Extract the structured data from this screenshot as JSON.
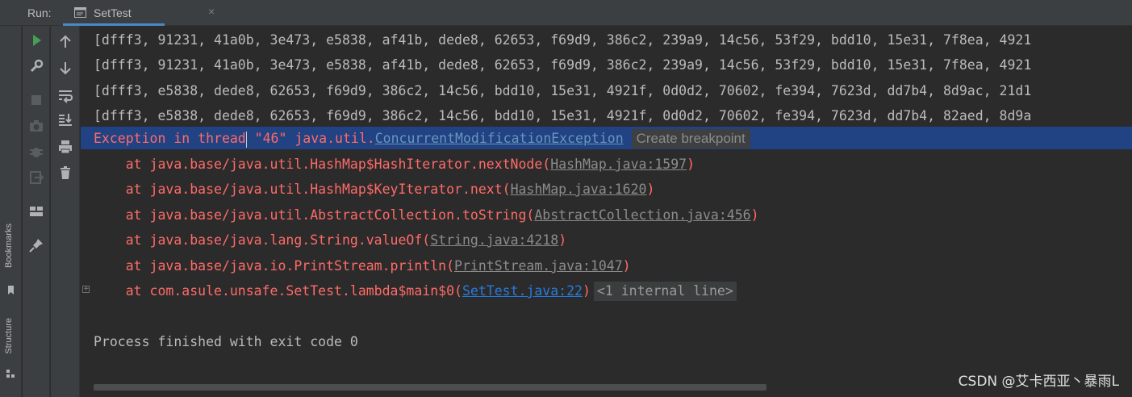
{
  "header": {
    "run_label": "Run:",
    "tab_label": "SetTest",
    "tab_close": "×"
  },
  "stripe": {
    "bookmarks_label": "Bookmarks",
    "structure_label": "Structure"
  },
  "toolbar": {
    "left_icons": [
      "run-icon",
      "wrench-icon",
      "stop-icon",
      "camera-icon",
      "debug-icon",
      "exit-icon",
      "layout-icon",
      "pin-icon"
    ],
    "right_icons": [
      "up-arrow-icon",
      "down-arrow-icon",
      "soft-wrap-icon",
      "scroll-to-end-icon",
      "print-icon",
      "trash-icon"
    ]
  },
  "console": {
    "output_lines": [
      "[dfff3, 91231, 41a0b, 3e473, e5838, af41b, dede8, 62653, f69d9, 386c2, 239a9, 14c56, 53f29, bdd10, 15e31, 7f8ea, 4921",
      "[dfff3, 91231, 41a0b, 3e473, e5838, af41b, dede8, 62653, f69d9, 386c2, 239a9, 14c56, 53f29, bdd10, 15e31, 7f8ea, 4921",
      "[dfff3, e5838, dede8, 62653, f69d9, 386c2, 14c56, bdd10, 15e31, 4921f, 0d0d2, 70602, fe394, 7623d, dd7b4, 8d9ac, 21d1",
      "[dfff3, e5838, dede8, 62653, f69d9, 386c2, 14c56, bdd10, 15e31, 4921f, 0d0d2, 70602, fe394, 7623d, dd7b4, 82aed, 8d9a"
    ],
    "exception": {
      "prefix_a": "Exception in thread",
      "prefix_b": " \"46\" java.util.",
      "class_name": "ConcurrentModificationException",
      "breakpoint_hint": "Create breakpoint"
    },
    "stack": [
      {
        "text": "    at java.base/java.util.HashMap$HashIterator.nextNode(",
        "link": "HashMap.java:1597",
        "tail": ")"
      },
      {
        "text": "    at java.base/java.util.HashMap$KeyIterator.next(",
        "link": "HashMap.java:1620",
        "tail": ")"
      },
      {
        "text": "    at java.base/java.util.AbstractCollection.toString(",
        "link": "AbstractCollection.java:456",
        "tail": ")"
      },
      {
        "text": "    at java.base/java.lang.String.valueOf(",
        "link": "String.java:4218",
        "tail": ")"
      },
      {
        "text": "    at java.base/java.io.PrintStream.println(",
        "link": "PrintStream.java:1047",
        "tail": ")"
      }
    ],
    "last_frame": {
      "text": "    at com.asule.unsafe.SetTest.lambda$main$0(",
      "link": "SetTest.java:22",
      "tail": ")",
      "fold_hint": "<1 internal line>"
    },
    "fold_symbol": "+",
    "exit_message": "Process finished with exit code 0"
  },
  "watermark": "CSDN @艾卡西亚丶暴雨L",
  "colors": {
    "background": "#2b2b2b",
    "error": "#ff6b68",
    "selection": "#214283",
    "link_blue": "#287bde"
  }
}
